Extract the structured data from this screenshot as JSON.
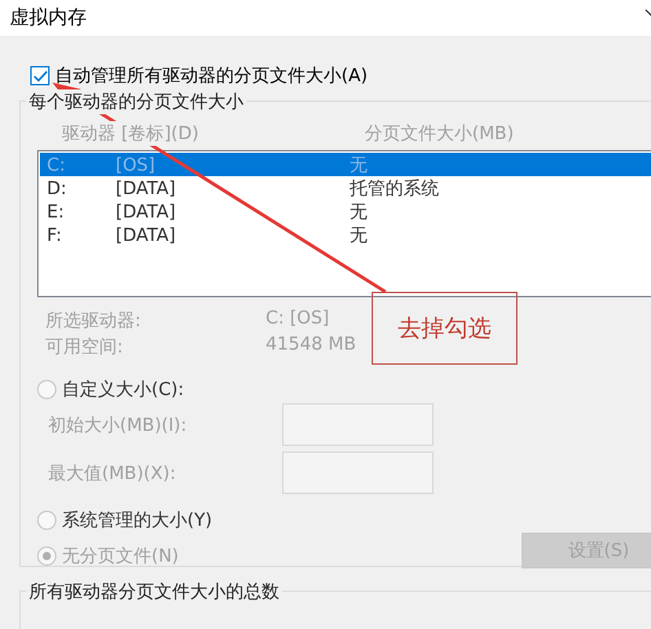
{
  "window": {
    "title": "虚拟内存"
  },
  "auto_manage": {
    "label": "自动管理所有驱动器的分页文件大小(A)",
    "checked": true
  },
  "per_drive": {
    "title": "每个驱动器的分页文件大小",
    "disabled": true,
    "columns": [
      "驱动器 [卷标](D)",
      "分页文件大小(MB)"
    ],
    "rows": [
      {
        "drive": "C:",
        "label": "[OS]",
        "size": "无",
        "selected": true
      },
      {
        "drive": "D:",
        "label": "[DATA]",
        "size": "托管的系统",
        "selected": false
      },
      {
        "drive": "E:",
        "label": "[DATA]",
        "size": "无",
        "selected": false
      },
      {
        "drive": "F:",
        "label": "[DATA]",
        "size": "无",
        "selected": false
      }
    ],
    "info": [
      {
        "label": "所选驱动器:",
        "value": "C:  [OS]"
      },
      {
        "label": "可用空间:",
        "value": "41548 MB"
      }
    ],
    "custom": {
      "label": "自定义大小(C):",
      "selected": false
    },
    "fields": [
      {
        "label": "初始大小(MB)(I):"
      },
      {
        "label": "最大值(MB)(X):"
      }
    ],
    "system": {
      "label": "系统管理的大小(Y)",
      "selected": false
    },
    "none": {
      "label": "无分页文件(N)",
      "selected": true
    },
    "set_button": {
      "label": "设置(S)"
    }
  },
  "total": {
    "title": "所有驱动器分页文件大小的总数"
  },
  "annotation": {
    "text": "去掉勾选"
  }
}
